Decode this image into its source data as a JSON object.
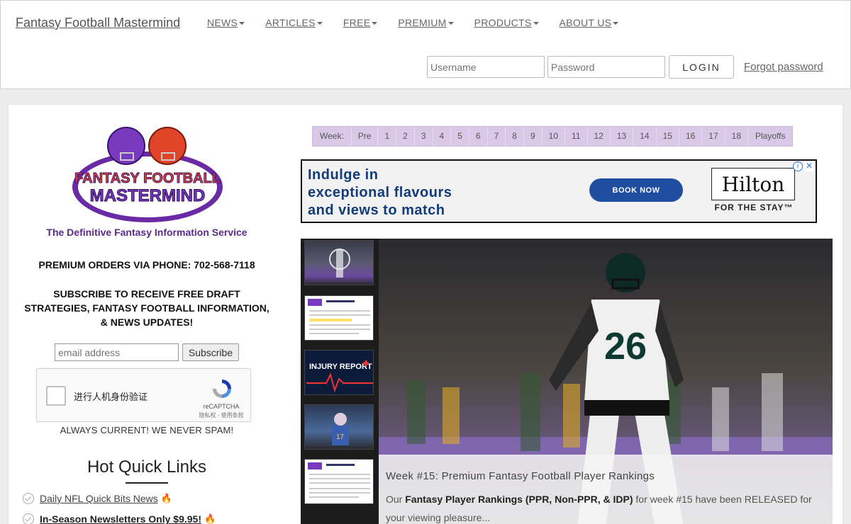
{
  "header": {
    "brand": "Fantasy Football Mastermind",
    "nav": [
      {
        "label": "NEWS"
      },
      {
        "label": "ARTICLES"
      },
      {
        "label": "FREE"
      },
      {
        "label": "PREMIUM"
      },
      {
        "label": "PRODUCTS"
      },
      {
        "label": "ABOUT US"
      }
    ],
    "login": {
      "username_placeholder": "Username",
      "password_placeholder": "Password",
      "login_label": "LOGIN",
      "forgot_label": "Forgot password"
    }
  },
  "sidebar": {
    "logo": {
      "line1": "FANTASY FOOTBALL",
      "line2": "MASTERMIND"
    },
    "tagline": "The Definitive Fantasy Information Service",
    "phone_text": "PREMIUM ORDERS VIA PHONE: 702-568-7118",
    "subscribe_text": "SUBSCRIBE TO RECEIVE FREE DRAFT STRATEGIES, FANTASY FOOTBALL INFORMATION, & NEWS UPDATES!",
    "email_placeholder": "email address",
    "subscribe_button": "Subscribe",
    "captcha": {
      "label": "进行人机身份验证",
      "brand": "reCAPTCHA",
      "links": "隐私权 - 使用条款"
    },
    "nospam": "ALWAYS CURRENT! WE NEVER SPAM!",
    "hot_links_title": "Hot Quick Links",
    "quick_links": [
      {
        "label": "Daily NFL Quick Bits News"
      },
      {
        "label": "In-Season Newsletters Only $9.95!"
      }
    ]
  },
  "weekbar": {
    "label": "Week:",
    "weeks": [
      "Pre",
      "1",
      "2",
      "3",
      "4",
      "5",
      "6",
      "7",
      "8",
      "9",
      "10",
      "11",
      "12",
      "13",
      "14",
      "15",
      "16",
      "17",
      "18",
      "Playoffs"
    ]
  },
  "ad": {
    "headline_1": "Indulge in",
    "headline_2": "exceptional flavours",
    "headline_3": "and views to match",
    "button": "BOOK NOW",
    "brand": "Hilton",
    "slogan": "FOR THE STAY™",
    "info_glyph": "i",
    "close_glyph": "✕"
  },
  "slider": {
    "thumbs": [
      {
        "kind": "photo-field"
      },
      {
        "kind": "document"
      },
      {
        "kind": "injury-report",
        "text": "INJURY REPORT"
      },
      {
        "kind": "photo-player"
      },
      {
        "kind": "document"
      }
    ],
    "hero": {
      "jersey_number": "26"
    },
    "caption_title": "Week #15: Premium Fantasy Football Player Rankings",
    "caption_pre": "Our ",
    "caption_bold": "Fantasy Player Rankings (PPR, Non-PPR, & IDP)",
    "caption_post": " for week #15 have been RELEASED for your viewing pleasure..."
  },
  "colors": {
    "weekbar_bg": "#d9c8e8",
    "brand_purple": "#5a2a8a",
    "ad_button": "#1f4ea1",
    "fire": "#e05a1c"
  }
}
